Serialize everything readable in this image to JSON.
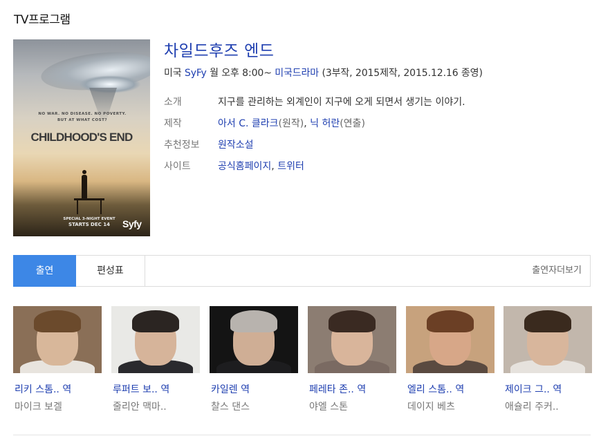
{
  "section_title": "TV프로그램",
  "poster": {
    "tagline": "NO WAR. NO DISEASE. NO POVERTY. BUT AT WHAT COST?",
    "logo_text": "CHILDHOOD'S END",
    "event_line1": "SPECIAL 3-NIGHT EVENT",
    "event_line2": "STARTS DEC 14",
    "network_logo": "Syfy"
  },
  "program": {
    "title": "차일드후즈 엔드",
    "meta_country": "미국",
    "meta_channel": "SyFy",
    "meta_time": "월 오후 8:00~",
    "meta_genre": "미국드라마",
    "meta_detail": "(3부작, 2015제작, 2015.12.16 종영)",
    "rows": {
      "intro_label": "소개",
      "intro_value": "지구를 관리하는 외계인이 지구에 오게 되면서 생기는 이야기.",
      "credits_label": "제작",
      "credits_author": "아서 C. 클라크",
      "credits_author_role": "(원작)",
      "credits_director": "닉 허란",
      "credits_director_role": "(연출)",
      "recommend_label": "추천정보",
      "recommend_value": "원작소설",
      "site_label": "사이트",
      "site_home": "공식홈페이지",
      "site_twitter": "트위터"
    }
  },
  "tabs": {
    "cast": "출연",
    "schedule": "편성표",
    "more": "출연자더보기"
  },
  "cast": [
    {
      "role": "리키 스톰.. 역",
      "actor": "마이크 보겔",
      "colors": {
        "bg": "#8a6f57",
        "skin": "#d8b79a",
        "hair": "#6b4a2c",
        "body": "#e8e4de"
      }
    },
    {
      "role": "루퍼트 보.. 역",
      "actor": "줄리안 맥마..",
      "colors": {
        "bg": "#e9e9e6",
        "skin": "#d6b49a",
        "hair": "#2b2522",
        "body": "#2a2a2e"
      }
    },
    {
      "role": "카일렌 역",
      "actor": "찰스 댄스",
      "colors": {
        "bg": "#141414",
        "skin": "#cfae95",
        "hair": "#b8b3ae",
        "body": "#1d1d1f"
      }
    },
    {
      "role": "페레타 존.. 역",
      "actor": "야엘 스톤",
      "colors": {
        "bg": "#8c7d72",
        "skin": "#d9b59b",
        "hair": "#3a2a22",
        "body": "#7a6a62"
      }
    },
    {
      "role": "엘리 스톰.. 역",
      "actor": "데이지 베츠",
      "colors": {
        "bg": "#c7a27d",
        "skin": "#d7a788",
        "hair": "#6b3f25",
        "body": "#5a4a40"
      }
    },
    {
      "role": "제이크 그.. 역",
      "actor": "애슐리 주커..",
      "colors": {
        "bg": "#c2b7ac",
        "skin": "#d8b69c",
        "hair": "#3a2a1e",
        "body": "#e6e2dd"
      }
    }
  ]
}
